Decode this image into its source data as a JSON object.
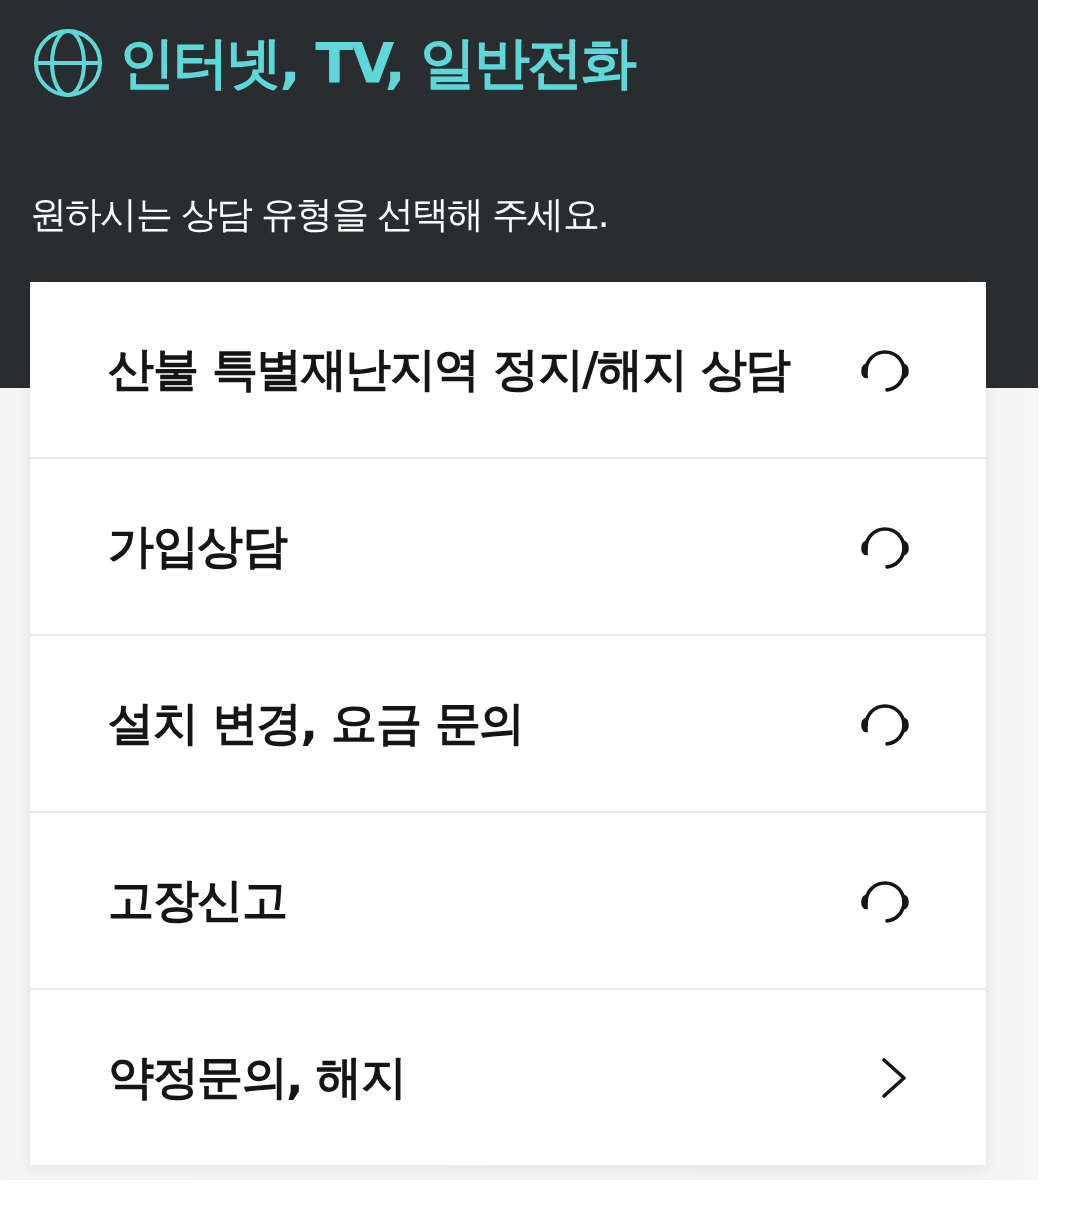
{
  "header": {
    "title": "인터넷, TV, 일반전화",
    "subtitle": "원하시는 상담 유형을 선택해 주세요."
  },
  "options": [
    {
      "label": "산불 특별재난지역 정지/해지 상담",
      "kind": "call"
    },
    {
      "label": "가입상담",
      "kind": "call"
    },
    {
      "label": "설치 변경, 요금 문의",
      "kind": "call"
    },
    {
      "label": "고장신고",
      "kind": "call"
    },
    {
      "label": "약정문의, 해지",
      "kind": "link"
    }
  ]
}
